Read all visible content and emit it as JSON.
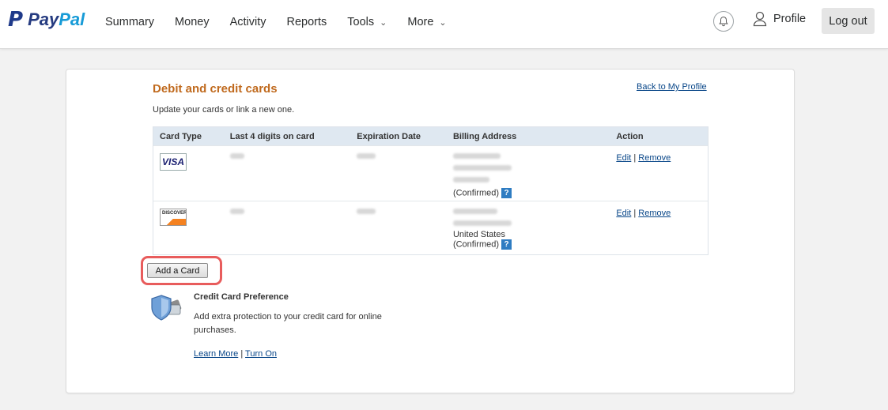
{
  "nav": {
    "logo": "PayPal",
    "items": [
      {
        "label": "Summary"
      },
      {
        "label": "Money"
      },
      {
        "label": "Activity"
      },
      {
        "label": "Reports"
      },
      {
        "label": "Tools",
        "has_dropdown": true
      },
      {
        "label": "More",
        "has_dropdown": true
      }
    ],
    "profile_label": "Profile",
    "logout_label": "Log out"
  },
  "cards_page": {
    "title": "Debit and credit cards",
    "back_link": "Back to My Profile",
    "subtitle": "Update your cards or link a new one.",
    "columns": [
      "Card Type",
      "Last 4 digits on card",
      "Expiration Date",
      "Billing Address",
      "Action"
    ],
    "rows": [
      {
        "card_type": "VISA",
        "address_tail": "(Confirmed)",
        "actions": {
          "edit": "Edit",
          "remove": "Remove"
        }
      },
      {
        "card_type": "DISCOVER",
        "address_country": "United States",
        "address_tail": "(Confirmed)",
        "actions": {
          "edit": "Edit",
          "remove": "Remove"
        }
      }
    ],
    "help_glyph": "?",
    "add_card_label": "Add a Card"
  },
  "preference": {
    "title": "Credit Card Preference",
    "description": "Add extra protection to your credit card for online purchases.",
    "learn_more": "Learn More",
    "turn_on": "Turn On"
  },
  "colors": {
    "title_orange": "#c06a1e",
    "link_blue": "#084688",
    "highlight_red": "#e85c5c",
    "table_header_bg": "#dfe8f1"
  }
}
